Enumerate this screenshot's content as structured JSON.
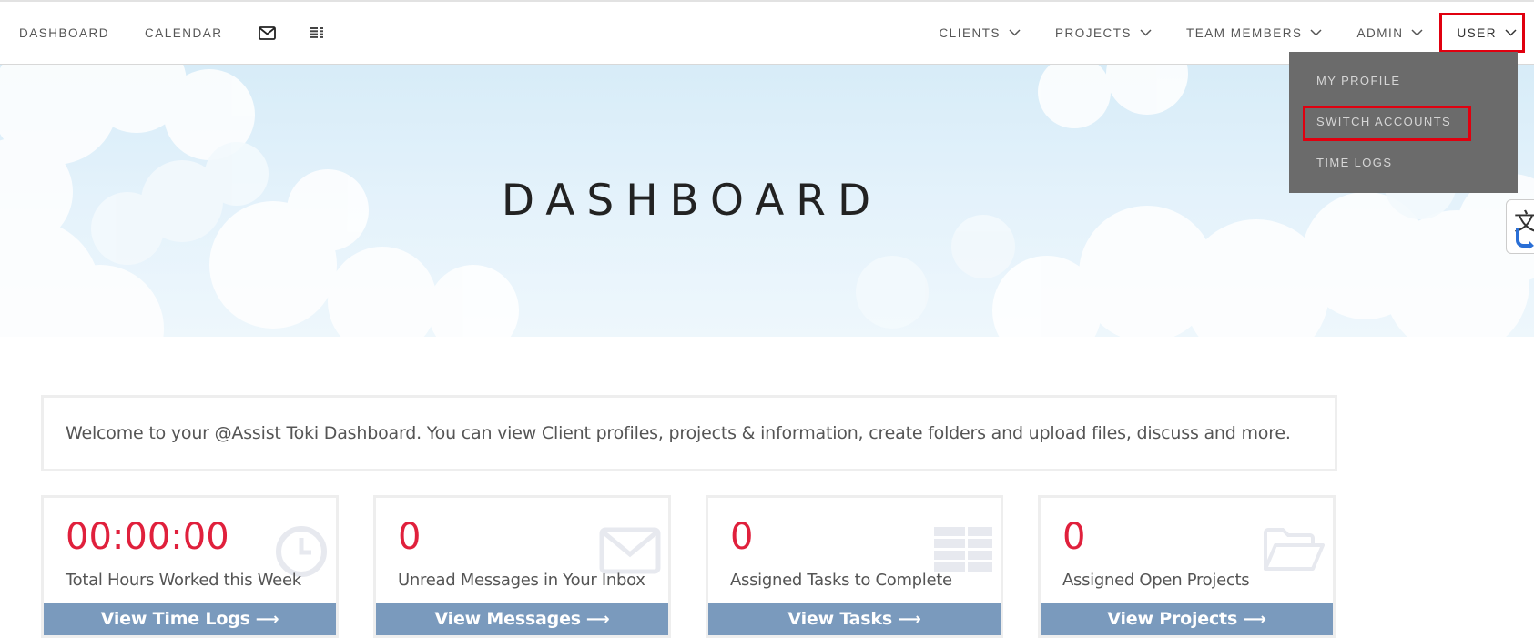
{
  "nav": {
    "left": [
      {
        "label": "DASHBOARD"
      },
      {
        "label": "CALENDAR"
      }
    ],
    "icons": [
      "envelope-icon",
      "tasks-icon"
    ],
    "right": [
      {
        "label": "CLIENTS"
      },
      {
        "label": "PROJECTS"
      },
      {
        "label": "TEAM MEMBERS"
      },
      {
        "label": "ADMIN"
      },
      {
        "label": "USER"
      }
    ]
  },
  "hero": {
    "title": "DASHBOARD"
  },
  "user_menu": {
    "items": [
      {
        "label": "MY PROFILE"
      },
      {
        "label": "SWITCH ACCOUNTS"
      },
      {
        "label": "TIME LOGS"
      }
    ]
  },
  "translate_widget": {
    "glyph": "文"
  },
  "welcome": {
    "text": "Welcome to your @Assist Toki Dashboard. You can view Client profiles, projects & information, create folders and upload files, discuss and more."
  },
  "cards": [
    {
      "value": "00:00:00",
      "label": "Total Hours Worked this Week",
      "button": "View Time Logs",
      "icon": "clock-icon"
    },
    {
      "value": "0",
      "label": "Unread Messages in Your Inbox",
      "button": "View Messages",
      "icon": "envelope-icon"
    },
    {
      "value": "0",
      "label": "Assigned Tasks to Complete",
      "button": "View Tasks",
      "icon": "tasks-icon"
    },
    {
      "value": "0",
      "label": "Assigned Open Projects",
      "button": "View Projects",
      "icon": "folder-open-icon"
    }
  ],
  "colors": {
    "accent_red": "#e0203c",
    "button_blue": "#7a9abd",
    "dropdown_bg": "#6b6b6b",
    "highlight_red": "#e0000f"
  }
}
